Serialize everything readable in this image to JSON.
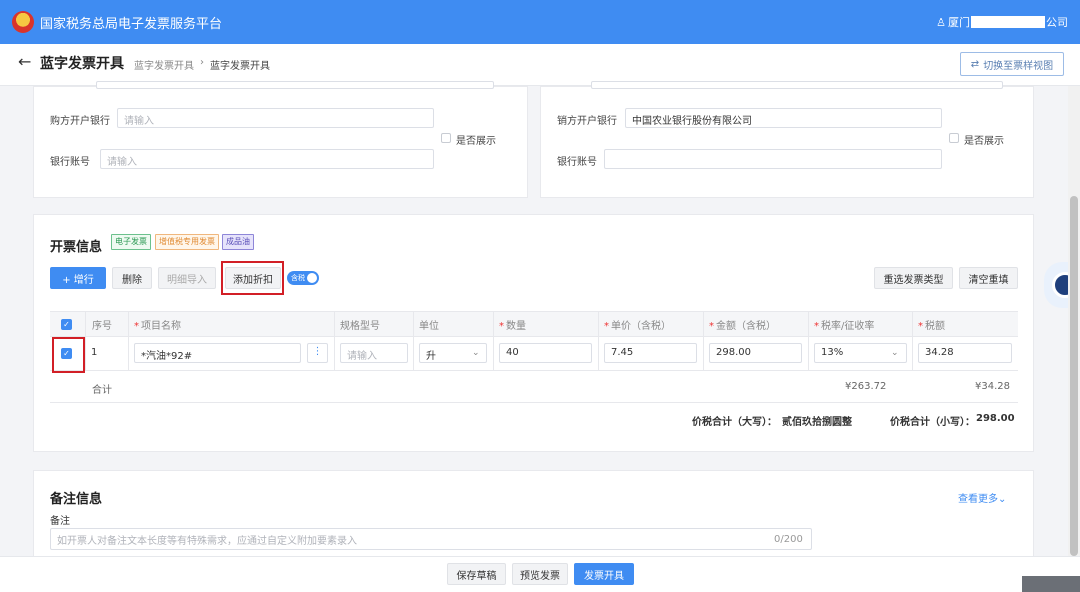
{
  "app": {
    "title": "国家税务总局电子发票服务平台",
    "user_prefix": "厦门",
    "user_suffix": "公司"
  },
  "header": {
    "title": "蓝字发票开具",
    "breadcrumb": [
      "蓝字发票开具",
      "蓝字发票开具"
    ],
    "switch_label": "切换至票样视图"
  },
  "buyer": {
    "bank_label": "购方开户银行",
    "bank_placeholder": "请输入",
    "account_label": "银行账号",
    "account_placeholder": "请输入",
    "show_label": "是否展示"
  },
  "seller": {
    "bank_label": "销方开户银行",
    "bank_value": "中国农业银行股份有限公司",
    "account_label": "银行账号",
    "account_value": "",
    "show_label": "是否展示"
  },
  "invoice": {
    "section_title": "开票信息",
    "tags": [
      "电子发票",
      "增值税专用发票",
      "成品油"
    ],
    "buttons": {
      "add_row": "+ 增行",
      "delete": "删除",
      "import_detail": "明细导入",
      "add_discount": "添加折扣",
      "reselect_type": "重选发票类型",
      "clear": "清空重填"
    },
    "tax_toggle": "含税",
    "columns": [
      "序号",
      "项目名称",
      "规格型号",
      "单位",
      "数量",
      "单价（含税）",
      "金额（含税）",
      "税率/征收率",
      "税额"
    ],
    "required_cols": [
      "项目名称",
      "数量",
      "单价（含税）",
      "金额（含税）",
      "税率/征收率",
      "税额"
    ],
    "rows": [
      {
        "index": "1",
        "item_name": "*汽油*92#",
        "spec_placeholder": "请输入",
        "unit": "升",
        "quantity": "40",
        "unit_price": "7.45",
        "amount": "298.00",
        "tax_rate": "13%",
        "tax": "34.28"
      }
    ],
    "total_label": "合计",
    "total_amount": "¥263.72",
    "total_tax": "¥34.28",
    "grand_total_upper_label": "价税合计（大写）：",
    "grand_total_upper": "贰佰玖拾捌圆整",
    "grand_total_lower_label": "价税合计（小写）：",
    "grand_total_lower": "298.00"
  },
  "remarks": {
    "section_title": "备注信息",
    "view_more": "查看更多",
    "label": "备注",
    "placeholder": "如开票人对备注文本长度等有特殊需求，应通过自定义附加要素录入",
    "counter": "0/200"
  },
  "footer": {
    "save_draft": "保存草稿",
    "preview": "预览发票",
    "issue": "发票开具"
  },
  "colors": {
    "primary": "#3f8cf2",
    "highlight": "#d21f26"
  }
}
